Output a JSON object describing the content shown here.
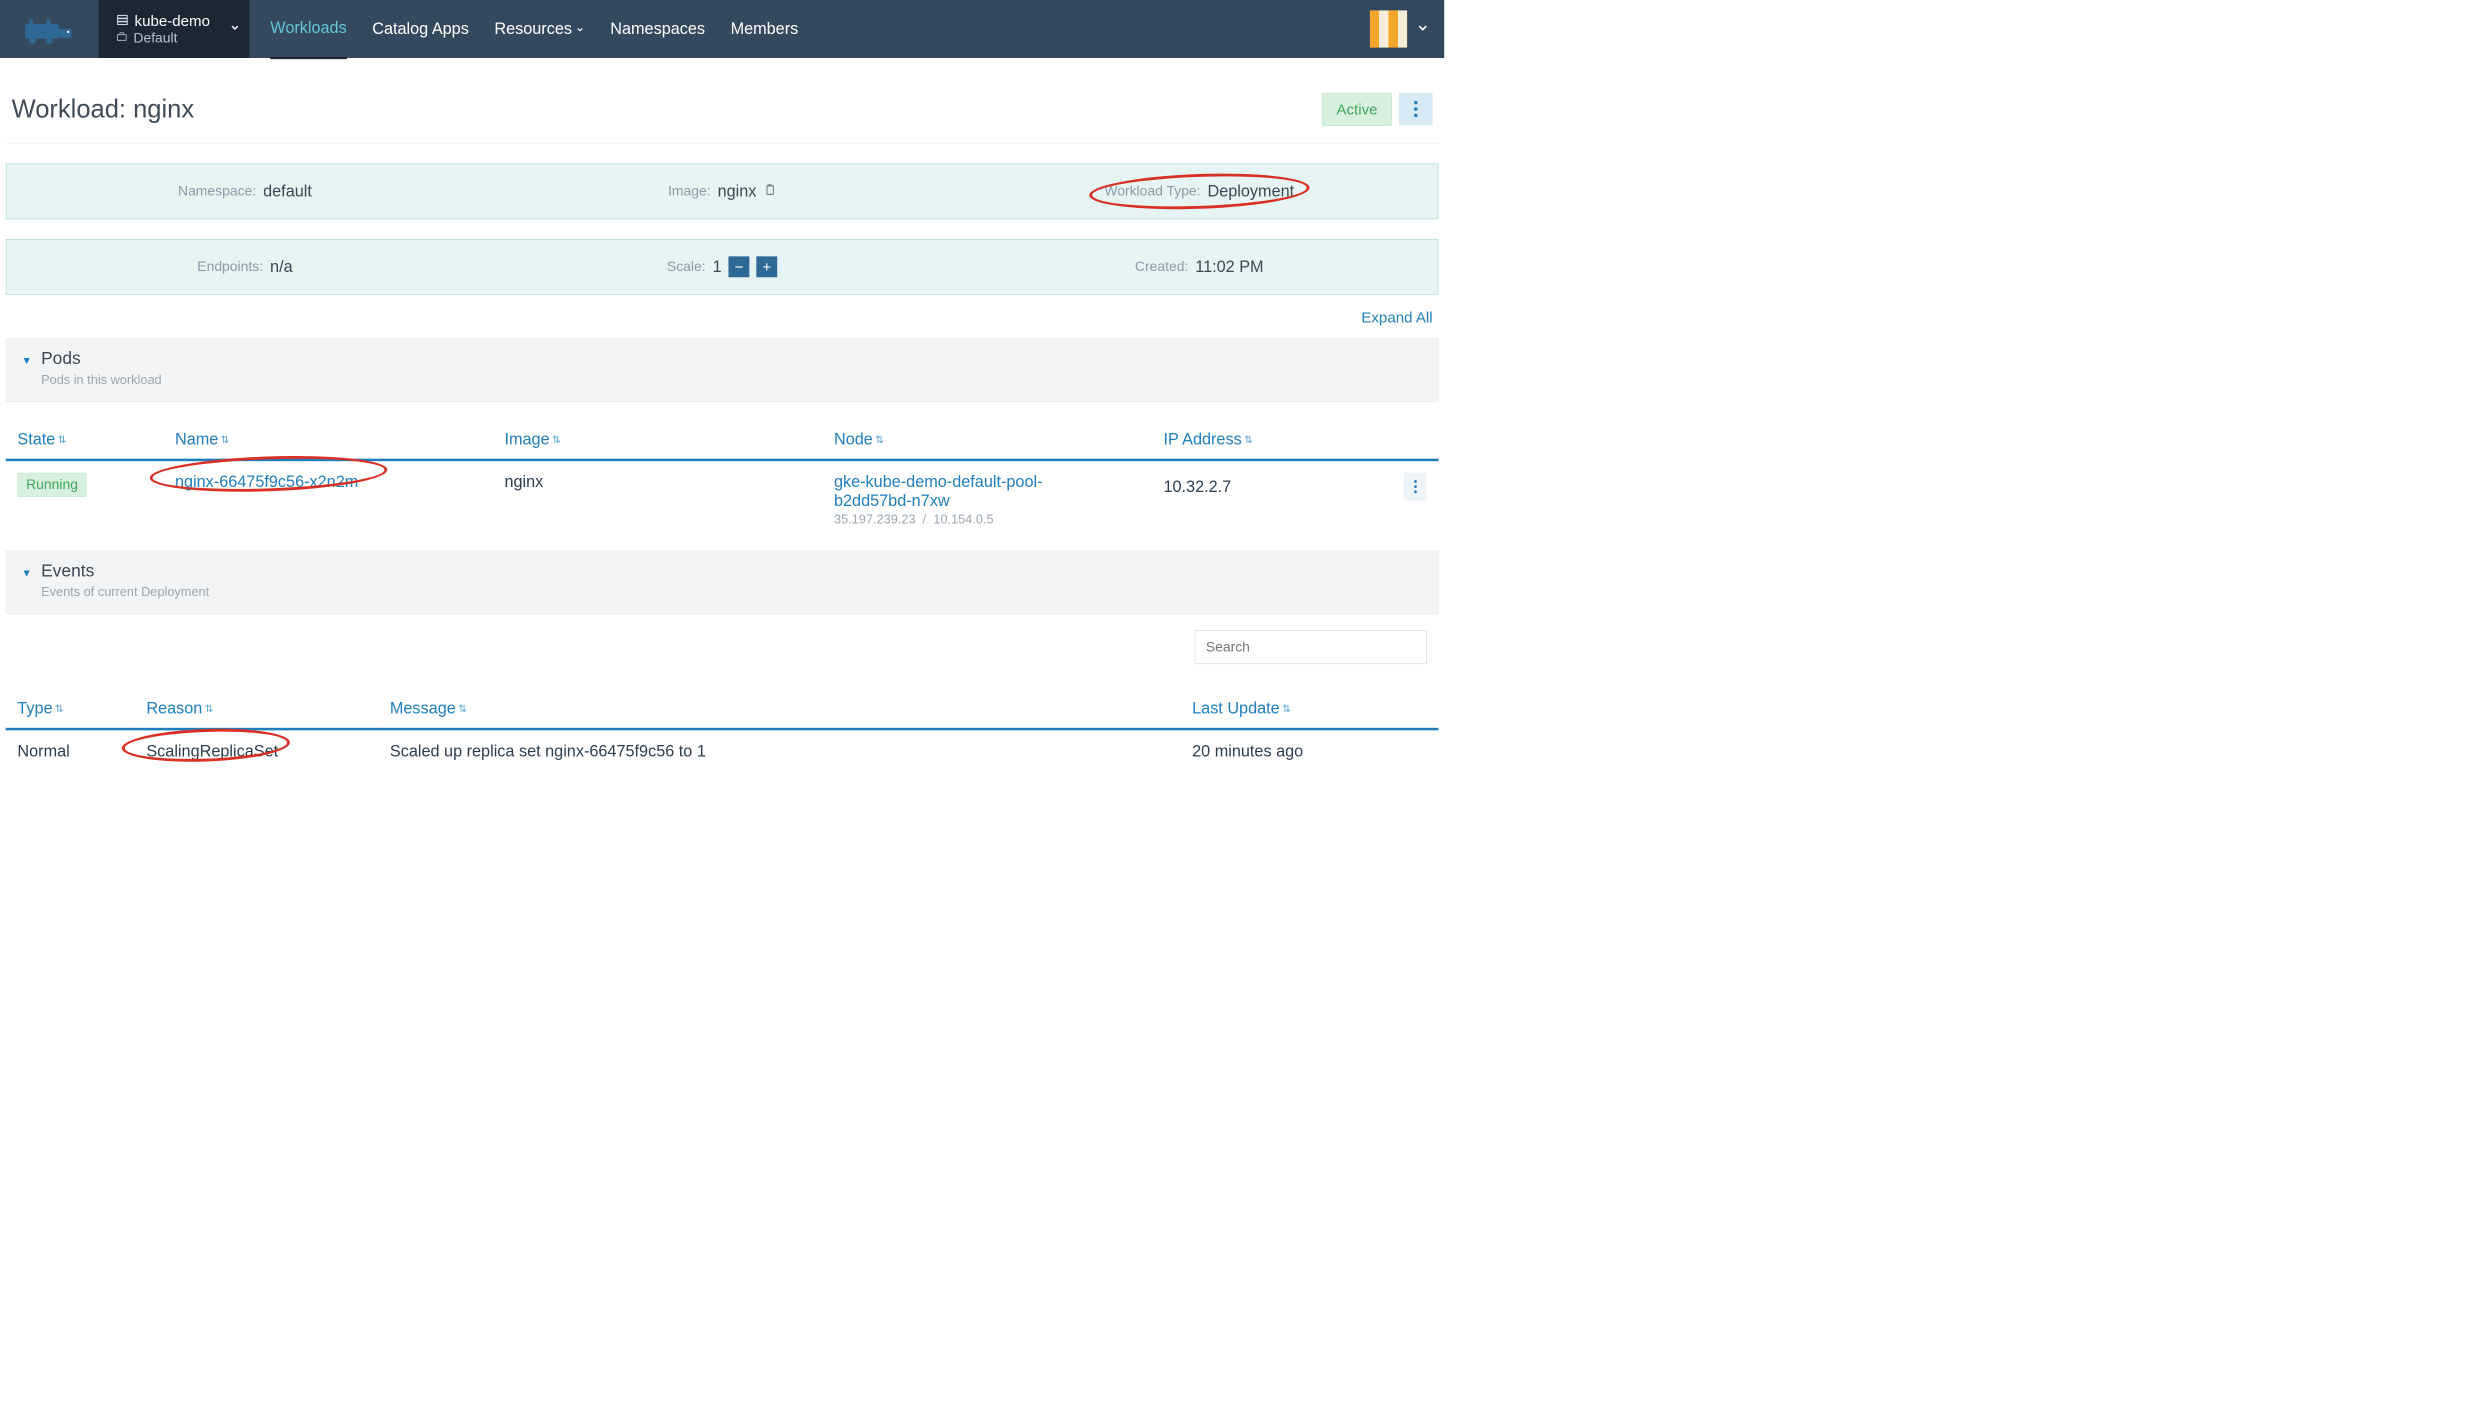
{
  "navbar": {
    "cluster_name": "kube-demo",
    "project_name": "Default",
    "links": [
      "Workloads",
      "Catalog Apps",
      "Resources",
      "Namespaces",
      "Members"
    ],
    "active_index": 0
  },
  "page": {
    "title": "Workload: nginx",
    "status": "Active",
    "expand_all": "Expand All"
  },
  "info_row1": {
    "namespace_label": "Namespace:",
    "namespace_value": "default",
    "image_label": "Image:",
    "image_value": "nginx",
    "type_label": "Workload Type:",
    "type_value": "Deployment"
  },
  "info_row2": {
    "endpoints_label": "Endpoints:",
    "endpoints_value": "n/a",
    "scale_label": "Scale:",
    "scale_value": "1",
    "created_label": "Created:",
    "created_value": "11:02 PM"
  },
  "pods_section": {
    "title": "Pods",
    "subtitle": "Pods in this workload",
    "columns": [
      "State",
      "Name",
      "Image",
      "Node",
      "IP Address"
    ],
    "rows": [
      {
        "state": "Running",
        "name": "nginx-66475f9c56-x2n2m",
        "image": "nginx",
        "node": "gke-kube-demo-default-pool-b2dd57bd-n7xw",
        "node_ip_ext": "35.197.239.23",
        "node_ip_int": "10.154.0.5",
        "ip": "10.32.2.7"
      }
    ]
  },
  "events_section": {
    "title": "Events",
    "subtitle": "Events of current Deployment",
    "search_placeholder": "Search",
    "columns": [
      "Type",
      "Reason",
      "Message",
      "Last Update"
    ],
    "rows": [
      {
        "type": "Normal",
        "reason": "ScalingReplicaSet",
        "message": "Scaled up replica set nginx-66475f9c56 to 1",
        "last_update": "20 minutes ago"
      }
    ]
  }
}
